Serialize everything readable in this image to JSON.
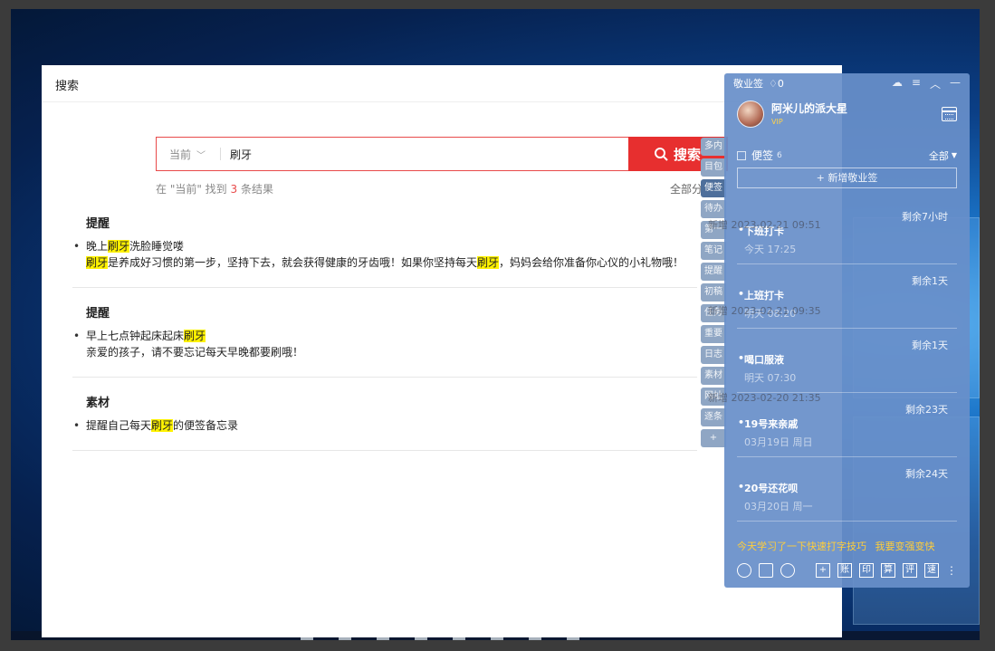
{
  "search_window": {
    "title": "搜索",
    "scope": "当前",
    "query": "刷牙",
    "search_button": "搜索",
    "result_prefix": "在 \"当前\" 找到 ",
    "result_count": "3",
    "result_suffix": " 条结果",
    "all_categories": "全部分类"
  },
  "results": [
    {
      "category": "提醒",
      "line1": [
        "晚上",
        "刷牙",
        "洗脸睡觉喽"
      ],
      "line2": [
        "",
        "刷牙",
        "是养成好习惯的第一步，坚持下去，就会获得健康的牙齿哦！如果你坚持每天",
        "刷牙",
        "，妈妈会给你准备你心仪的小礼物哦！"
      ]
    },
    {
      "category": "提醒",
      "line1": [
        "早上七点钟起床起床",
        "刷牙",
        ""
      ],
      "line2": [
        "亲爱的孩子，请不要忘记每天早晚都要刷哦！"
      ]
    },
    {
      "category": "素材",
      "line1": [
        "提醒自己每天",
        "刷牙",
        "的便签备忘录"
      ]
    }
  ],
  "side_tabs": [
    "多内",
    "目包",
    "便签",
    "待办",
    "第一",
    "笔记",
    "提醒",
    "初稿",
    "任务",
    "重要",
    "日志",
    "素材",
    "网址",
    "逐条",
    "+"
  ],
  "widget": {
    "app_name": "敬业签",
    "bell_count": "0",
    "username": "阿米儿的派大星",
    "vip": "VIP",
    "section": "便签",
    "section_count": "6",
    "filter": "全部",
    "new_button": "+ 新增敬业签",
    "notes": [
      {
        "remaining": "剩余7小时",
        "title": "下班打卡",
        "time": "今天 17:25"
      },
      {
        "remaining": "剩余1天",
        "title": "上班打卡",
        "time": "明天 08:20"
      },
      {
        "remaining": "剩余1天",
        "title": "喝口服液",
        "time": "明天 07:30"
      },
      {
        "remaining": "剩余23天",
        "title": "19号来亲戚",
        "time": "03月19日 周日"
      },
      {
        "remaining": "剩余24天",
        "title": "20号还花呗",
        "time": "03月20日 周一"
      }
    ],
    "tip": "今天学习了一下快速打字技巧",
    "tip_link": "我要变强变快",
    "bottom_boxes": [
      "+",
      "账",
      "印",
      "算",
      "评",
      "速"
    ]
  },
  "ghost_dates": [
    "新增 2023-02-21 09:51",
    "新增 2023-02-21 09:35",
    "新增 2023-02-20 21:35"
  ]
}
